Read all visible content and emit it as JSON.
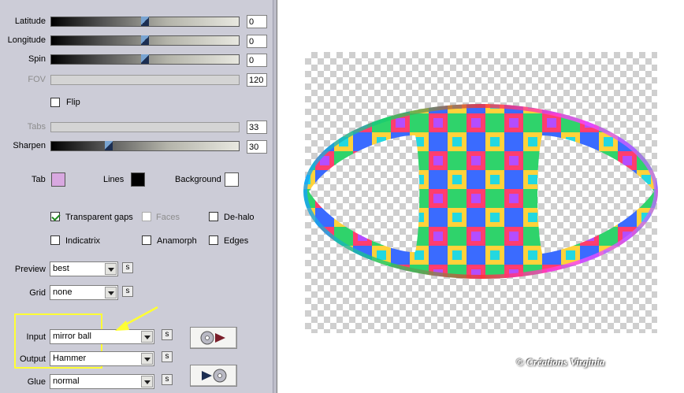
{
  "sliders": [
    {
      "label": "Latitude",
      "value": "0",
      "level": 0.5,
      "disabled": false
    },
    {
      "label": "Longitude",
      "value": "0",
      "level": 0.5,
      "disabled": false
    },
    {
      "label": "Spin",
      "value": "0",
      "level": 0.5,
      "disabled": false
    },
    {
      "label": "FOV",
      "value": "120",
      "disabled": true
    },
    {
      "label": "Tabs",
      "value": "33",
      "disabled": true
    },
    {
      "label": "Sharpen",
      "value": "30",
      "level": 0.3,
      "disabled": false
    }
  ],
  "flip": {
    "label": "Flip",
    "checked": false
  },
  "colors": {
    "tab": {
      "label": "Tab",
      "color": "#d8a8e0"
    },
    "lines": {
      "label": "Lines",
      "color": "#000000"
    },
    "background": {
      "label": "Background",
      "color": "#ffffff"
    }
  },
  "options": {
    "transparent_gaps": {
      "label": "Transparent gaps",
      "checked": true
    },
    "faces": {
      "label": "Faces",
      "checked": false,
      "disabled": true
    },
    "de_halo": {
      "label": "De-halo",
      "checked": false
    },
    "indicatrix": {
      "label": "Indicatrix",
      "checked": false
    },
    "anamorph": {
      "label": "Anamorph",
      "checked": false
    },
    "edges": {
      "label": "Edges",
      "checked": false
    }
  },
  "selects": {
    "preview": {
      "label": "Preview",
      "value": "best"
    },
    "grid": {
      "label": "Grid",
      "value": "none"
    },
    "input": {
      "label": "Input",
      "value": "mirror ball"
    },
    "output": {
      "label": "Output",
      "value": "Hammer"
    },
    "glue": {
      "label": "Glue",
      "value": "normal"
    }
  },
  "s_button_label": "s",
  "highlight_color": "#ffff33",
  "icons": [
    "disc-to-play-icon",
    "play-to-disc-icon"
  ],
  "watermark": "© Créations Virginia"
}
